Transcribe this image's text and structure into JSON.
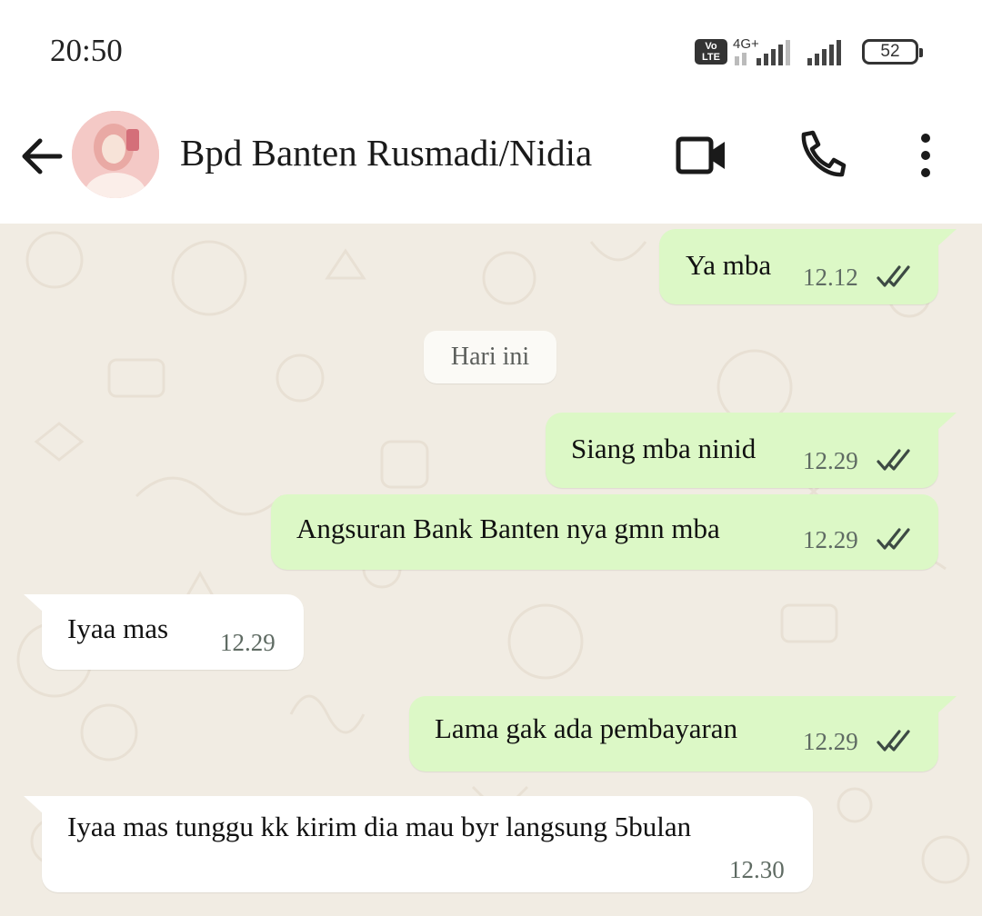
{
  "status_bar": {
    "time": "20:50",
    "volte_label": "Vo LTE",
    "network": "4G+",
    "battery": "52"
  },
  "header": {
    "contact_name": "Bpd Banten Rusmadi/Nidia",
    "icons": [
      "back-arrow-icon",
      "video-call-icon",
      "phone-icon",
      "more-options-icon"
    ]
  },
  "chat": {
    "date_separator": "Hari ini",
    "messages": [
      {
        "direction": "outgoing",
        "text": "Ya mba",
        "time": "12.12",
        "status": "read"
      },
      {
        "direction": "outgoing",
        "text": "Siang mba ninid",
        "time": "12.29",
        "status": "read"
      },
      {
        "direction": "outgoing",
        "text": "Angsuran Bank Banten nya gmn mba",
        "time": "12.29",
        "status": "read"
      },
      {
        "direction": "incoming",
        "text": "Iyaa mas",
        "time": "12.29"
      },
      {
        "direction": "outgoing",
        "text": "Lama gak ada pembayaran",
        "time": "12.29",
        "status": "read"
      },
      {
        "direction": "incoming",
        "text": "Iyaa mas tunggu kk kirim dia mau byr langsung 5bulan",
        "time": "12.30"
      }
    ]
  },
  "colors": {
    "outgoing_bubble": "#dcf8c6",
    "incoming_bubble": "#ffffff",
    "chat_background": "#f1ece3"
  }
}
